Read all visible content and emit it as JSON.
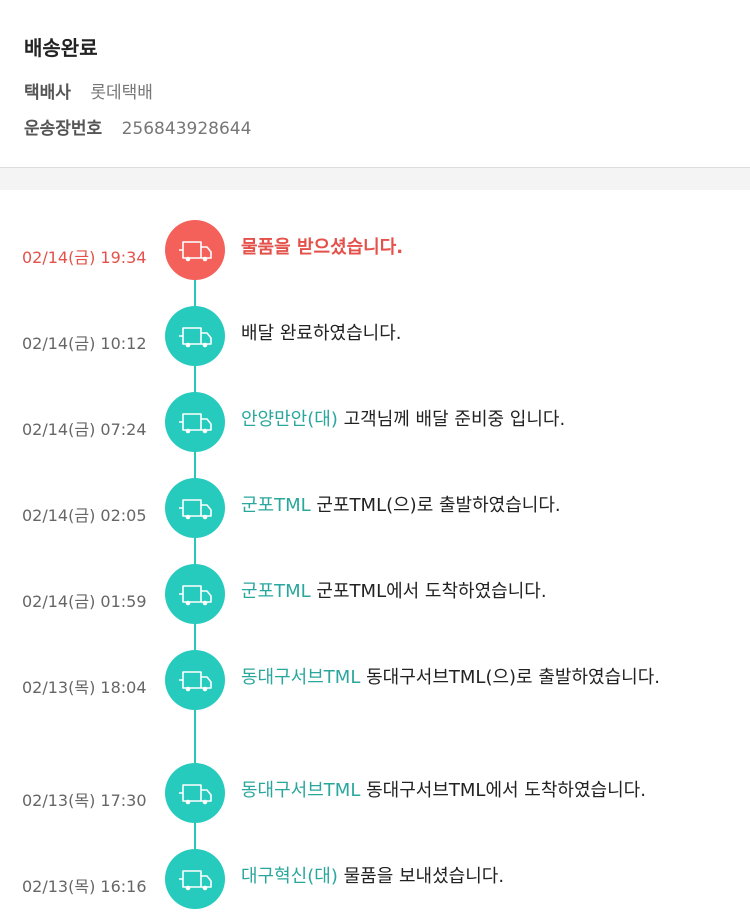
{
  "header": {
    "status": "배송완료",
    "carrier_label": "택배사",
    "carrier": "롯데택배",
    "tracking_label": "운송장번호",
    "tracking_number": "256843928644"
  },
  "colors": {
    "accent": "#26cbbe",
    "active": "#f4615a",
    "location_text": "#2aa79d"
  },
  "events": [
    {
      "time": "02/14(금) 19:34",
      "location": "",
      "message": "물품을 받으셨습니다.",
      "icon": "truck-icon",
      "active": true
    },
    {
      "time": "02/14(금) 10:12",
      "location": "",
      "message": "배달 완료하였습니다.",
      "icon": "truck-icon"
    },
    {
      "time": "02/14(금) 07:24",
      "location": "안양만안(대)",
      "message": "고객님께 배달 준비중 입니다.",
      "icon": "truck-icon"
    },
    {
      "time": "02/14(금) 02:05",
      "location": "군포TML",
      "message": "군포TML(으)로 출발하였습니다.",
      "icon": "truck-icon"
    },
    {
      "time": "02/14(금) 01:59",
      "location": "군포TML",
      "message": "군포TML에서 도착하였습니다.",
      "icon": "truck-icon"
    },
    {
      "time": "02/13(목) 18:04",
      "location": "동대구서브TML",
      "message": "동대구서브TML(으)로 출발하였습니다.",
      "icon": "truck-icon"
    },
    {
      "time": "02/13(목) 17:30",
      "location": "동대구서브TML",
      "message": "동대구서브TML에서 도착하였습니다.",
      "icon": "truck-icon"
    },
    {
      "time": "02/13(목) 16:16",
      "location": "대구혁신(대)",
      "message": "물품을 보내셨습니다.",
      "icon": "truck-icon"
    }
  ]
}
